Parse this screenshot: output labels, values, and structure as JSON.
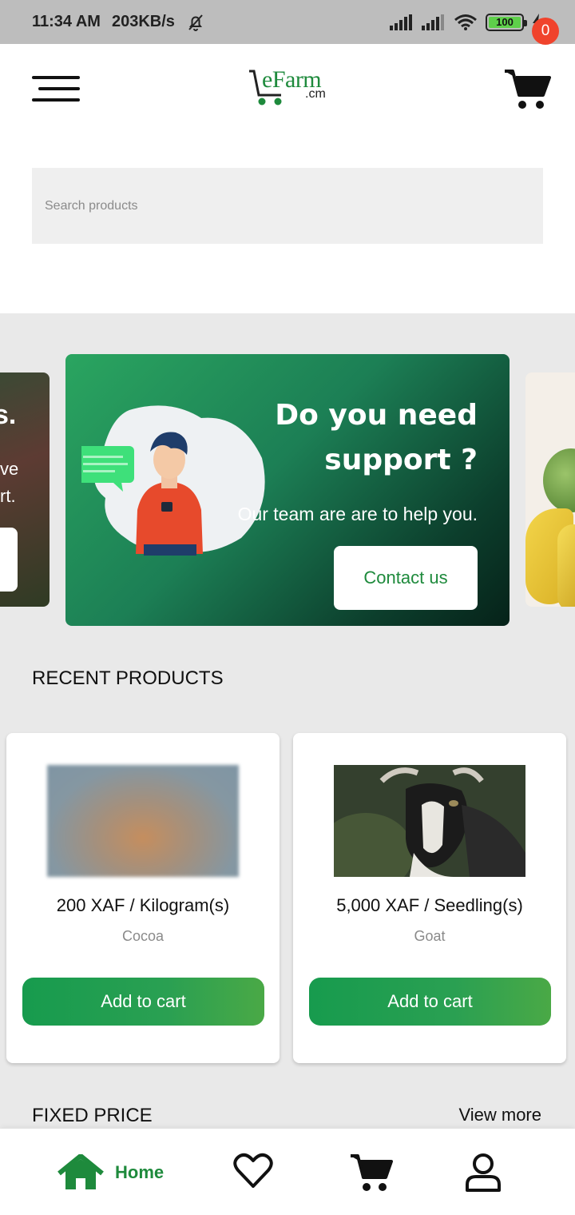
{
  "status_bar": {
    "time": "11:34 AM",
    "speed": "203KB/s",
    "battery": "100"
  },
  "header": {
    "logo_main": "eFarm",
    "logo_sub": ".cm",
    "cart_count": "0"
  },
  "search": {
    "placeholder": "Search products"
  },
  "carousel": {
    "left_card": {
      "big": "s.",
      "line1": "ve",
      "line2": "rt."
    },
    "promo": {
      "title_line1": "Do you need",
      "title_line2": "support ?",
      "subtitle": "Our team are are to help you.",
      "button": "Contact us"
    }
  },
  "recent_products": {
    "title": "RECENT PRODUCTS",
    "items": [
      {
        "price": "200 XAF / Kilogram(s)",
        "name": "Cocoa",
        "button": "Add to cart"
      },
      {
        "price": "5,000 XAF / Seedling(s)",
        "name": "Goat",
        "button": "Add to cart"
      }
    ]
  },
  "fixed_price": {
    "title": "FIXED PRICE",
    "view_more": "View more"
  },
  "bottom_nav": {
    "home_label": "Home",
    "icons": [
      "home-icon",
      "heart-icon",
      "cart-icon",
      "user-icon"
    ]
  },
  "colors": {
    "brand_green": "#1e8a3c",
    "badge_red": "#f0432c",
    "button_green": "#179b4e"
  }
}
